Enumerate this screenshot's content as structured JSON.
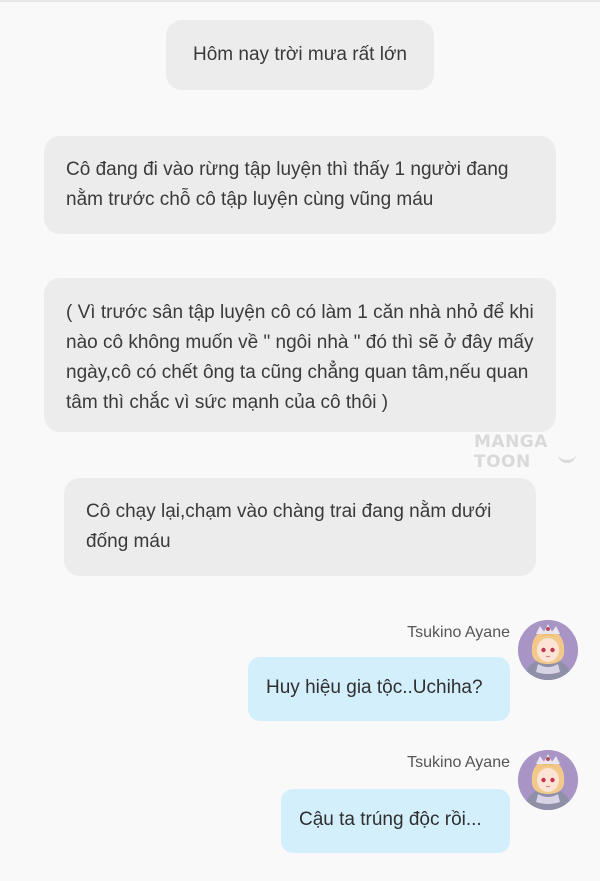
{
  "narration": [
    {
      "text": "Hôm nay trời mưa rất lớn"
    },
    {
      "text": "Cô đang đi vào rừng tập luyện thì thấy 1 người đang nằm trước chỗ cô tập luyện cùng vũng máu"
    },
    {
      "text": "( Vì trước sân tập luyện cô có làm 1 căn nhà nhỏ để khi nào cô không muốn về \" ngôi nhà \" đó thì sẽ ở đây mấy ngày,cô có chết ông ta cũng chẳng quan tâm,nếu quan tâm thì chắc vì sức mạnh của cô thôi )"
    },
    {
      "text": "Cô chạy lại,chạm vào chàng trai đang nằm dưới đống máu"
    }
  ],
  "watermark": "MANGA TOON",
  "messages": [
    {
      "speaker": "Tsukino Ayane",
      "text": "Huy hiệu gia tộc..Uchiha?",
      "avatar_icon": "character-avatar-icon"
    },
    {
      "speaker": "Tsukino Ayane",
      "text": "Cậu ta trúng độc rồi...",
      "avatar_icon": "character-avatar-icon"
    }
  ],
  "colors": {
    "background": "#f9f9f9",
    "narration_bubble": "#ececec",
    "message_bubble": "#d4effc",
    "watermark": "#d9d9d9"
  }
}
